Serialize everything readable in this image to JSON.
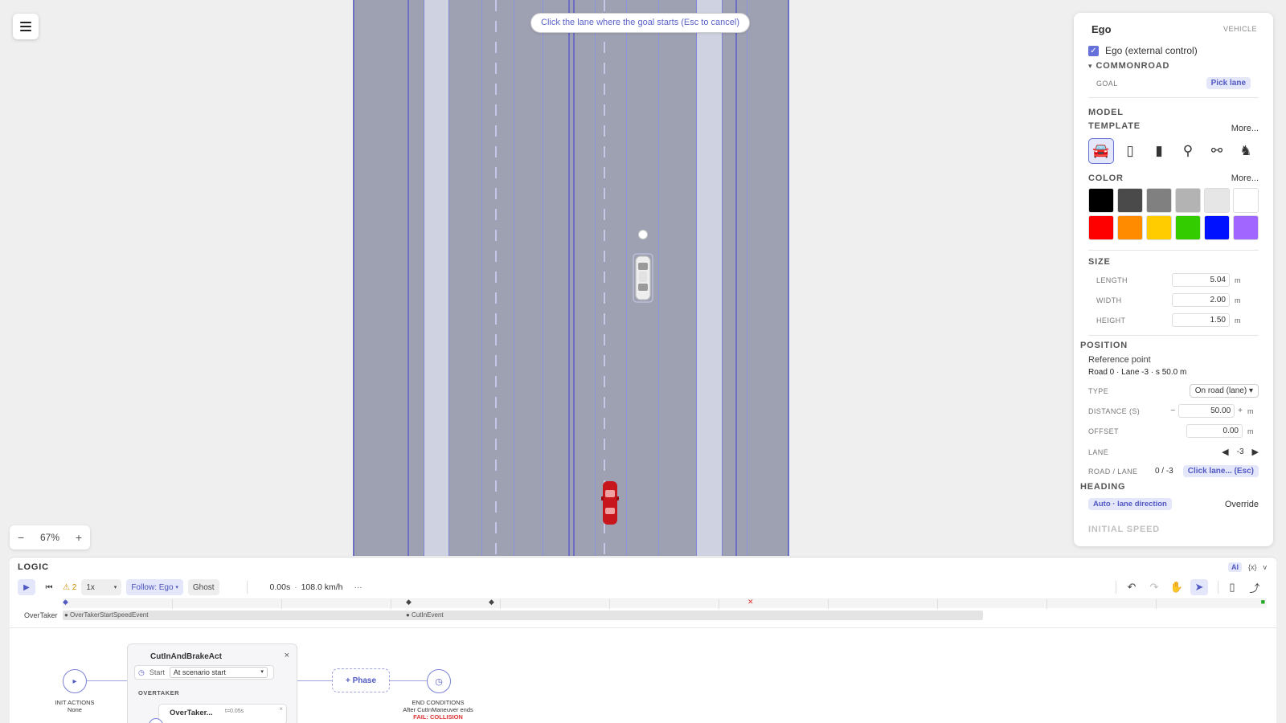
{
  "banner": "Click the lane where the goal starts (Esc to cancel)",
  "zoom": {
    "minus": "−",
    "value": "67%",
    "plus": "+"
  },
  "panel": {
    "title": "Ego",
    "type_label": "VEHICLE",
    "ego_checkbox": "Ego (external control)",
    "commonroad": "COMMONROAD",
    "commonroad_caret": "▾",
    "goal_label": "GOAL",
    "goal_action": "Pick lane",
    "model_template_line1": "MODEL",
    "model_template_line2": "TEMPLATE",
    "more1": "More...",
    "templates": [
      "car-icon",
      "van-icon",
      "bus-icon",
      "motorcycle-icon",
      "bicycle-icon",
      "pedestrian-icon"
    ],
    "color_label": "COLOR",
    "more2": "More...",
    "colors": [
      "#000000",
      "#4a4a4a",
      "#808080",
      "#b3b3b3",
      "#e6e6e6",
      "#ffffff",
      "#ff0000",
      "#ff8c00",
      "#ffcc00",
      "#33cc00",
      "#0011ff",
      "#a066ff"
    ],
    "size_label": "SIZE",
    "length_label": "LENGTH",
    "length_value": "5.04",
    "width_label": "WIDTH",
    "width_value": "2.00",
    "height_label": "HEIGHT",
    "height_value": "1.50",
    "unit_m": "m",
    "position_label": "POSITION",
    "ref_point_label": "Reference point",
    "ref_point_value": "Road 0 · Lane -3 · s 50.0 m",
    "type_field_label": "TYPE",
    "type_field_value": "On road (lane)",
    "distance_label": "DISTANCE (S)",
    "distance_value": "50.00",
    "offset_label": "OFFSET",
    "offset_value": "0.00",
    "lane_label": "LANE",
    "lane_value": "-3",
    "road_lane_label": "ROAD / LANE",
    "road_lane_value": "0 / -3",
    "road_lane_action": "Click lane... (Esc)",
    "heading_label": "HEADING",
    "heading_auto": "Auto · lane direction",
    "heading_override": "Override",
    "initial_speed_label": "INITIAL SPEED"
  },
  "logic": {
    "title": "LOGIC",
    "ai": "AI",
    "vars": "{x}",
    "collapse": "v",
    "warnings": "⚠ 2",
    "speed": "1x",
    "follow": "Follow: Ego",
    "ghost": "Ghost",
    "time": "0.00s",
    "sep": "·",
    "velocity": "108.0 km/h",
    "more": "···",
    "lane_name": "OverTaker",
    "event1": "● OverTakerStartSpeedEvent",
    "event2": "● CutInEvent",
    "init_label": "INIT ACTIONS",
    "init_value": "None",
    "act_title": "CutInAndBrakeAct",
    "act_close": "×",
    "start_label": "Start",
    "start_value": "At scenario start",
    "overtaker_section": "OVERTAKER",
    "ev_card_title": "OverTaker...",
    "ev_card_time": "t=0.05s",
    "ev_card_close": "×",
    "phase_button": "+ Phase",
    "end_label": "END CONDITIONS",
    "end_value": "After CutInManeuver ends",
    "end_fail": "FAIL: COLLISION"
  }
}
